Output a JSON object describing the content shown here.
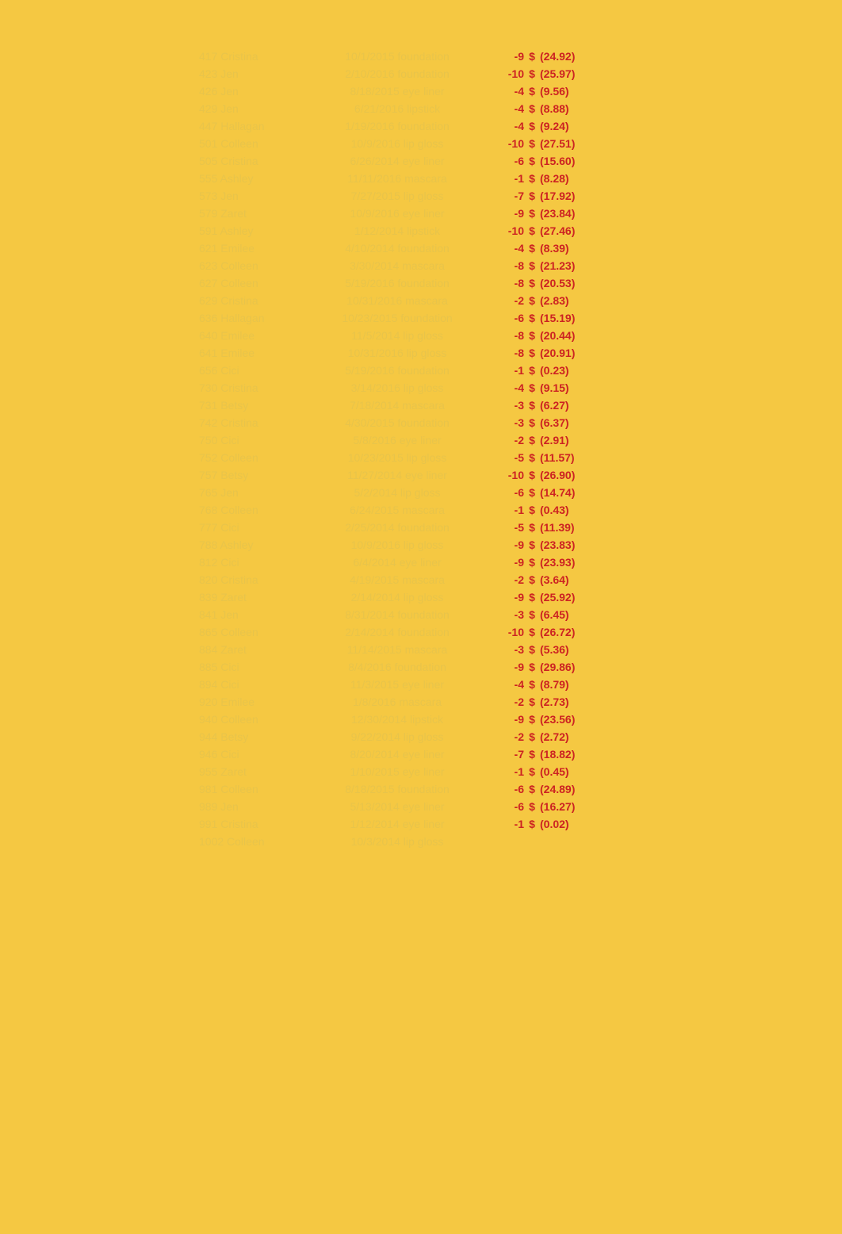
{
  "rows": [
    {
      "id": "417 Cristina",
      "date_product": "10/1/2015 foundation",
      "qty": "-9",
      "amount": "(24.92)"
    },
    {
      "id": "423 Jen",
      "date_product": "2/10/2016 foundation",
      "qty": "-10",
      "amount": "(25.97)"
    },
    {
      "id": "426 Jen",
      "date_product": "8/18/2015 eye liner",
      "qty": "-4",
      "amount": "(9.56)"
    },
    {
      "id": "429 Jen",
      "date_product": "6/21/2016 lipstick",
      "qty": "-4",
      "amount": "(8.88)"
    },
    {
      "id": "447 Hallagan",
      "date_product": "1/19/2016 foundation",
      "qty": "-4",
      "amount": "(9.24)"
    },
    {
      "id": "501 Colleen",
      "date_product": "10/9/2016 lip gloss",
      "qty": "-10",
      "amount": "(27.51)"
    },
    {
      "id": "505 Cristina",
      "date_product": "6/26/2014 eye liner",
      "qty": "-6",
      "amount": "(15.60)"
    },
    {
      "id": "555 Ashley",
      "date_product": "11/11/2016 mascara",
      "qty": "-1",
      "amount": "(8.28)"
    },
    {
      "id": "573 Jen",
      "date_product": "7/27/2015 lip gloss",
      "qty": "-7",
      "amount": "(17.92)"
    },
    {
      "id": "579 Zaret",
      "date_product": "10/9/2016 eye liner",
      "qty": "-9",
      "amount": "(23.84)"
    },
    {
      "id": "591 Ashley",
      "date_product": "1/12/2014 lipstick",
      "qty": "-10",
      "amount": "(27.46)"
    },
    {
      "id": "621 Emilee",
      "date_product": "4/10/2014 foundation",
      "qty": "-4",
      "amount": "(8.39)"
    },
    {
      "id": "623 Colleen",
      "date_product": "3/30/2014 mascara",
      "qty": "-8",
      "amount": "(21.23)"
    },
    {
      "id": "627 Colleen",
      "date_product": "5/19/2016 foundation",
      "qty": "-8",
      "amount": "(20.53)"
    },
    {
      "id": "629 Cristina",
      "date_product": "10/31/2016 mascara",
      "qty": "-2",
      "amount": "(2.83)"
    },
    {
      "id": "636 Hallagan",
      "date_product": "10/23/2015 foundation",
      "qty": "-6",
      "amount": "(15.19)"
    },
    {
      "id": "640 Emilee",
      "date_product": "11/5/2014 lip gloss",
      "qty": "-8",
      "amount": "(20.44)"
    },
    {
      "id": "641 Emilee",
      "date_product": "10/31/2016 lip gloss",
      "qty": "-8",
      "amount": "(20.91)"
    },
    {
      "id": "656 Cici",
      "date_product": "5/19/2016 foundation",
      "qty": "-1",
      "amount": "(0.23)"
    },
    {
      "id": "730 Cristina",
      "date_product": "3/14/2016 lip gloss",
      "qty": "-4",
      "amount": "(9.15)"
    },
    {
      "id": "731 Betsy",
      "date_product": "7/18/2014 mascara",
      "qty": "-3",
      "amount": "(6.27)"
    },
    {
      "id": "742 Cristina",
      "date_product": "4/30/2015 foundation",
      "qty": "-3",
      "amount": "(6.37)"
    },
    {
      "id": "750 Cici",
      "date_product": "5/8/2016 eye liner",
      "qty": "-2",
      "amount": "(2.91)"
    },
    {
      "id": "752 Colleen",
      "date_product": "10/23/2015 lip gloss",
      "qty": "-5",
      "amount": "(11.57)"
    },
    {
      "id": "757 Betsy",
      "date_product": "11/27/2014 eye liner",
      "qty": "-10",
      "amount": "(26.90)"
    },
    {
      "id": "765 Jen",
      "date_product": "5/2/2014 lip gloss",
      "qty": "-6",
      "amount": "(14.74)"
    },
    {
      "id": "768 Colleen",
      "date_product": "6/24/2015 mascara",
      "qty": "-1",
      "amount": "(0.43)"
    },
    {
      "id": "777 Cici",
      "date_product": "2/25/2014 foundation",
      "qty": "-5",
      "amount": "(11.39)"
    },
    {
      "id": "788 Ashley",
      "date_product": "10/9/2016 lip gloss",
      "qty": "-9",
      "amount": "(23.83)"
    },
    {
      "id": "812 Cici",
      "date_product": "6/4/2014 eye liner",
      "qty": "-9",
      "amount": "(23.93)"
    },
    {
      "id": "820 Cristina",
      "date_product": "4/19/2015 mascara",
      "qty": "-2",
      "amount": "(3.64)"
    },
    {
      "id": "839 Zaret",
      "date_product": "2/14/2014 lip gloss",
      "qty": "-9",
      "amount": "(25.92)"
    },
    {
      "id": "841 Jen",
      "date_product": "8/31/2014 foundation",
      "qty": "-3",
      "amount": "(6.45)"
    },
    {
      "id": "865 Colleen",
      "date_product": "2/14/2014 foundation",
      "qty": "-10",
      "amount": "(26.72)"
    },
    {
      "id": "884 Zaret",
      "date_product": "11/14/2015 mascara",
      "qty": "-3",
      "amount": "(5.36)"
    },
    {
      "id": "885 Cici",
      "date_product": "8/4/2016 foundation",
      "qty": "-9",
      "amount": "(29.86)"
    },
    {
      "id": "894 Cici",
      "date_product": "11/3/2015 eye liner",
      "qty": "-4",
      "amount": "(8.79)"
    },
    {
      "id": "920 Emilee",
      "date_product": "1/8/2016 mascara",
      "qty": "-2",
      "amount": "(2.73)"
    },
    {
      "id": "940 Colleen",
      "date_product": "12/30/2014 lipstick",
      "qty": "-9",
      "amount": "(23.56)"
    },
    {
      "id": "944 Betsy",
      "date_product": "9/22/2014 lip gloss",
      "qty": "-2",
      "amount": "(2.72)"
    },
    {
      "id": "946 Cici",
      "date_product": "8/20/2014 eye liner",
      "qty": "-7",
      "amount": "(18.82)"
    },
    {
      "id": "955 Zaret",
      "date_product": "1/10/2015 eye liner",
      "qty": "-1",
      "amount": "(0.45)"
    },
    {
      "id": "981 Colleen",
      "date_product": "8/18/2015 foundation",
      "qty": "-6",
      "amount": "(24.89)"
    },
    {
      "id": "989 Jen",
      "date_product": "5/13/2014 eye liner",
      "qty": "-6",
      "amount": "(16.27)"
    },
    {
      "id": "991 Cristina",
      "date_product": "1/12/2014 eye liner",
      "qty": "-1",
      "amount": "(0.02)"
    },
    {
      "id": "1002 Colleen",
      "date_product": "10/3/2014 lip gloss",
      "qty": "",
      "amount": ""
    }
  ]
}
